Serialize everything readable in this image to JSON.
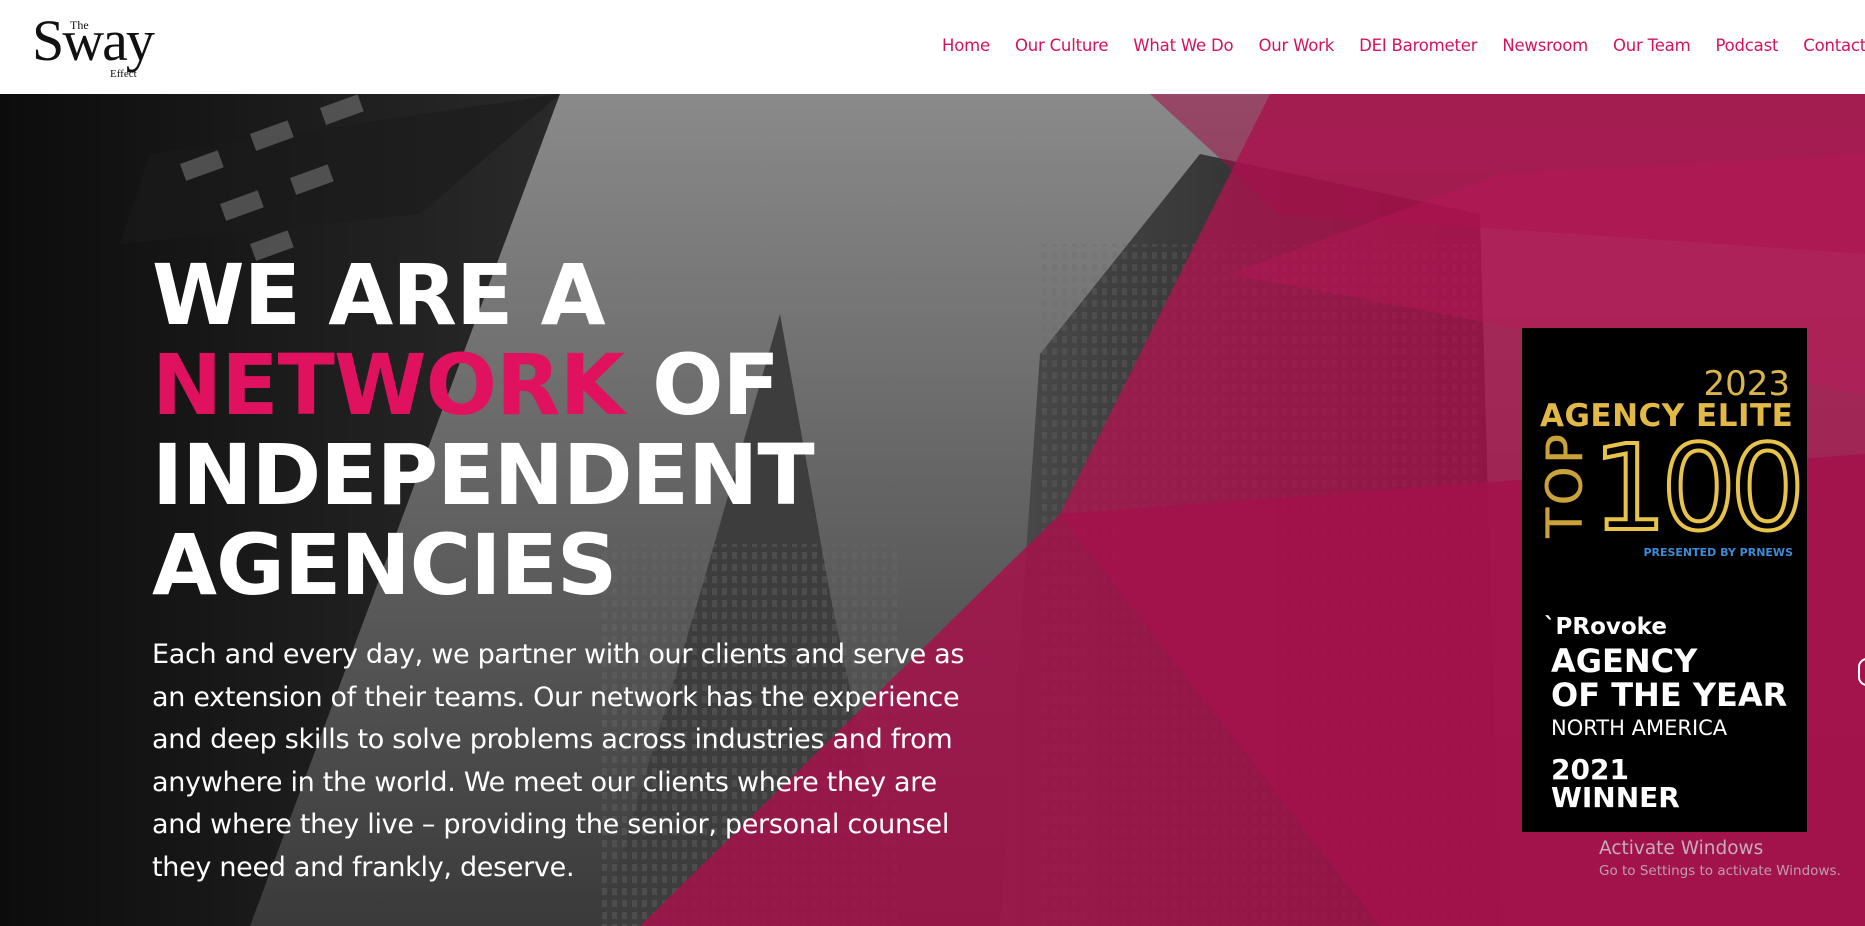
{
  "brand": {
    "logo_top": "The",
    "logo_main": "Sway",
    "logo_bottom": "Effect"
  },
  "nav": {
    "items": [
      {
        "label": "Home"
      },
      {
        "label": "Our Culture"
      },
      {
        "label": "What We Do"
      },
      {
        "label": "Our Work"
      },
      {
        "label": "DEI Barometer"
      },
      {
        "label": "Newsroom"
      },
      {
        "label": "Our Team"
      },
      {
        "label": "Podcast"
      },
      {
        "label": "Contact U"
      }
    ]
  },
  "hero": {
    "line1": "WE ARE A",
    "line2_accent": "NETWORK",
    "line2_rest": " OF",
    "line3": "INDEPENDENT",
    "line4": "AGENCIES",
    "body": "Each and every day, we partner with our clients and serve as an extension of their teams. Our network has the experience and deep skills to solve problems across industries and from anywhere in the world. We meet our clients where they are and where they live – providing the senior, personal counsel they need and frankly, deserve."
  },
  "badge": {
    "year": "2023",
    "title": "AGENCY ELITE",
    "top": "TOP",
    "hundred": "100",
    "presented": "PRESENTED BY PRNEWS",
    "provoke": "`PRovoke",
    "award_line1": "AGENCY",
    "award_line2": "OF THE YEAR",
    "region": "NORTH AMERICA",
    "winner_year": "2021",
    "winner": "WINNER"
  },
  "watermark": {
    "title": "Activate Windows",
    "subtitle": "Go to Settings to activate Windows."
  },
  "colors": {
    "accent": "#e0115f",
    "nav_link": "#d6125e",
    "overlay": "#b0134f",
    "gold": "#e2b946"
  }
}
